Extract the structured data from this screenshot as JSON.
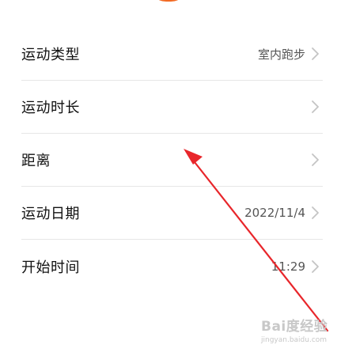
{
  "rows": [
    {
      "label": "运动类型",
      "value": "室内跑步"
    },
    {
      "label": "运动时长",
      "value": ""
    },
    {
      "label": "距离",
      "value": ""
    },
    {
      "label": "运动日期",
      "value": "2022/11/4"
    },
    {
      "label": "开始时间",
      "value": "11:29"
    }
  ],
  "icons": {
    "chevron": "chevron-right-icon",
    "annotation": "red-arrow"
  },
  "colors": {
    "accent": "#f26a24",
    "annotation": "#e8262b",
    "chevron": "#c4c4c4"
  },
  "watermark": {
    "line1": "Bai度经验",
    "line2": "jingyan.baidu.com"
  }
}
